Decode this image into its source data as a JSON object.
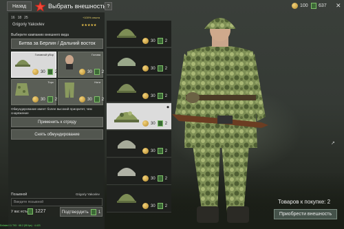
{
  "header": {
    "back_label": "Назад",
    "title": "Выбрать внешность",
    "help_label": "?",
    "silver_amount": "100",
    "gold_amount": "637",
    "close_symbol": "✕"
  },
  "soldier": {
    "level": "16",
    "rank_1": "18",
    "rank_2": "25",
    "bonus": "+100% опыта",
    "name": "Grigoriy Yakovlev",
    "stars": "★★★★★"
  },
  "campaign": {
    "label": "Выберите кампанию внешнего вида",
    "selected": "Битва за Берлин / Дальний восток"
  },
  "slots": [
    {
      "label": "Головной убор",
      "price": "30",
      "count": "2",
      "selected": true
    },
    {
      "label": "Голова",
      "price": "30",
      "count": "2",
      "selected": false
    },
    {
      "label": "Торс",
      "price": "30",
      "count": "2",
      "selected": false
    },
    {
      "label": "Ноги",
      "price": "30",
      "count": "2",
      "selected": false
    }
  ],
  "notice": "Обмундирование имеет более высокий приоритет, чем снаряжение",
  "buttons": {
    "apply_squad": "Применить к отряду",
    "remove_uniform": "Снять обмундирование",
    "confirm": "Подтвердить",
    "confirm_count": "1",
    "buy": "Приобрести внешность"
  },
  "callsign": {
    "label": "Позывной",
    "owner": "Grigoriy Yakovlev",
    "placeholder": "Введите позывной",
    "have_label": "У вас есть",
    "have_count": "1227"
  },
  "list": [
    {
      "price": "30",
      "count": "2",
      "selected": false
    },
    {
      "price": "30",
      "count": "2",
      "selected": false
    },
    {
      "price": "30",
      "count": "2",
      "selected": false
    },
    {
      "price": "30",
      "count": "2",
      "selected": true
    },
    {
      "price": "30",
      "count": "2",
      "selected": false
    },
    {
      "price": "30",
      "count": "2",
      "selected": false
    },
    {
      "price": "30",
      "count": "2",
      "selected": false
    }
  ],
  "cart": {
    "label": "Товаров к покупке: 2"
  },
  "debug_text": "Enlisted 11 T93 · 68.2 (55 fps) · 4.423"
}
